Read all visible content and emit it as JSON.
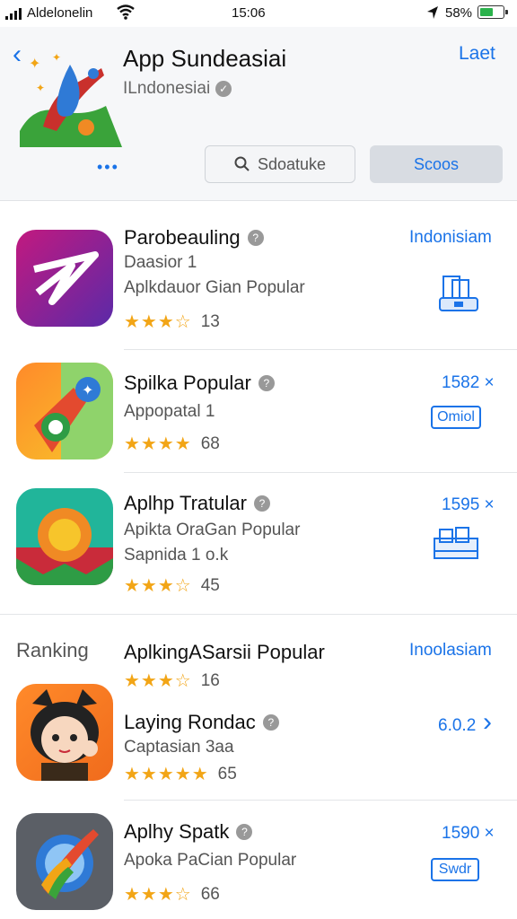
{
  "status_bar": {
    "carrier": "Aldelonelin",
    "time": "15:06",
    "battery": "58%",
    "battery_level": 0.58
  },
  "header": {
    "title": "App Sundeasiai",
    "subtitle": "ILndonesiai",
    "link": "Laet",
    "more": "•••",
    "search_label": "Sdoatuke",
    "scope_label": "Scoos"
  },
  "apps": [
    {
      "name": "Parobeauling",
      "line1": "Daasior 1",
      "line2": "Aplkdauor Gian Popular",
      "rating": 3.5,
      "stars": "★★★☆",
      "count": "13",
      "right": "Indonisiam"
    },
    {
      "name": "Spilka Popular",
      "line1": "Appopatal 1",
      "rating": 4,
      "stars": "★★★★",
      "count": "68",
      "right": "1582 ×",
      "button": "Omiol"
    },
    {
      "name": "Aplhp Tratular",
      "line1": "Apikta OraGan Popular",
      "line2": "Sapnida 1 o.k",
      "rating": 3.5,
      "stars": "★★★☆",
      "count": "45",
      "right": "1595 ×"
    }
  ],
  "ranking": {
    "label": "Ranking",
    "heading": "AplkingASarsii Popular",
    "heading_stars": "★★★☆",
    "heading_count": "16",
    "heading_right": "Inoolasiam",
    "items": [
      {
        "name": "Laying Rondac",
        "line1": "Captasian 3aa",
        "stars": "★★★★★",
        "count": "65",
        "right": "6.0.2"
      },
      {
        "name": "Aplhy Spatk",
        "line1": "Apoka PaCian Popular",
        "stars": "★★★☆",
        "count": "66",
        "right": "1590 ×",
        "button": "Swdr"
      }
    ]
  },
  "colors": {
    "accent": "#1a73e8",
    "star": "#f2a516",
    "header_bg": "#f6f7f9"
  }
}
